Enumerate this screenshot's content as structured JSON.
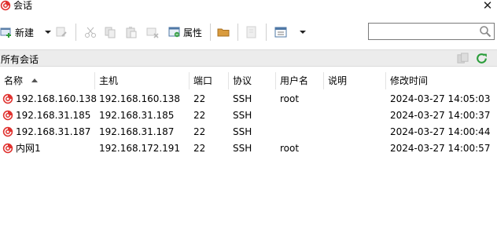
{
  "window": {
    "title": "会话",
    "close_label": "✕"
  },
  "toolbar": {
    "new_label": "新建",
    "properties_label": "属性",
    "icons": [
      "new-session-icon",
      "dropdown-arrow-icon",
      "edit-icon",
      "cut-icon",
      "copy-icon",
      "paste-icon",
      "delete-icon",
      "properties-icon",
      "folder-icon",
      "disabled-icon",
      "view-icon",
      "dropdown-arrow-icon"
    ]
  },
  "search": {
    "value": "",
    "placeholder": ""
  },
  "filter": {
    "label": "所有会话"
  },
  "table": {
    "columns": [
      "名称",
      "主机",
      "端口",
      "协议",
      "用户名",
      "说明",
      "修改时间"
    ],
    "rows": [
      {
        "name": "192.168.160.138",
        "host": "192.168.160.138",
        "port": "22",
        "protocol": "SSH",
        "user": "root",
        "desc": "",
        "modified": "2024-03-27 14:05:03"
      },
      {
        "name": "192.168.31.185",
        "host": "192.168.31.185",
        "port": "22",
        "protocol": "SSH",
        "user": "",
        "desc": "",
        "modified": "2024-03-27 14:00:37"
      },
      {
        "name": "192.168.31.187",
        "host": "192.168.31.187",
        "port": "22",
        "protocol": "SSH",
        "user": "",
        "desc": "",
        "modified": "2024-03-27 14:00:44"
      },
      {
        "name": "内网1",
        "host": "192.168.172.191",
        "port": "22",
        "protocol": "SSH",
        "user": "root",
        "desc": "",
        "modified": "2024-03-27 14:00:57"
      }
    ]
  },
  "colors": {
    "accent_red": "#e0322f",
    "refresh_green": "#2a9d3a",
    "filter_bg": "#ececec"
  }
}
